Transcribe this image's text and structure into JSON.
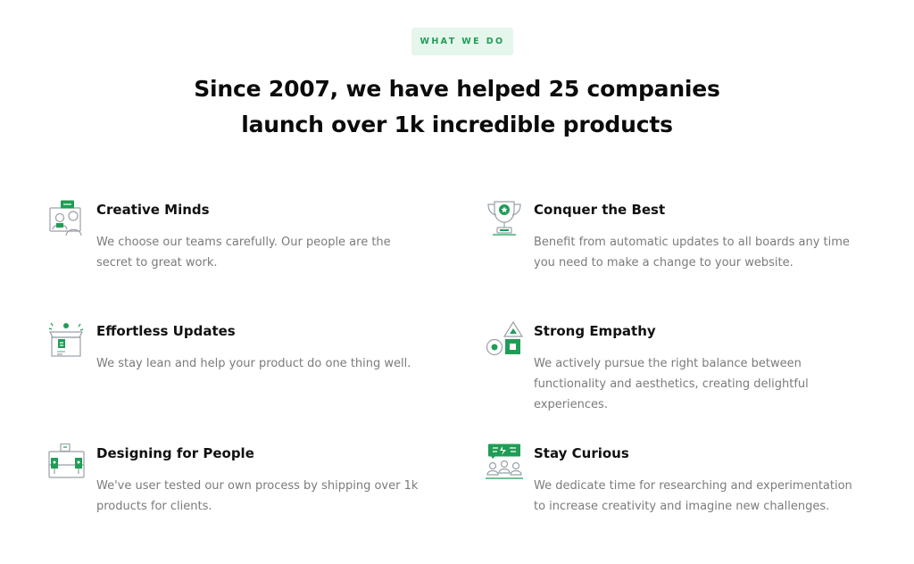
{
  "badge": "WHAT WE DO",
  "headline": {
    "line1": "Since 2007, we have helped 25 companies",
    "line2": "launch over 1k incredible products"
  },
  "colors": {
    "accent": "#1f9d55",
    "badge_bg": "#e5f6ec",
    "body_text": "#7b7b7b"
  },
  "features": [
    {
      "icon": "creative-minds-icon",
      "title": "Creative Minds",
      "description": "We choose our teams carefully. Our people are the secret to great work."
    },
    {
      "icon": "trophy-icon",
      "title": "Conquer the Best",
      "description": "Benefit from automatic updates to all boards any time you need to make a change to your website."
    },
    {
      "icon": "package-updates-icon",
      "title": "Effortless Updates",
      "description": "We stay lean and help your product do one thing well."
    },
    {
      "icon": "shapes-icon",
      "title": "Strong Empathy",
      "description": "We actively pursue the right balance between functionality and aesthetics, creating delightful experiences."
    },
    {
      "icon": "toolbox-icon",
      "title": "Designing for People",
      "description": "We've user tested our own process by shipping over 1k products for clients."
    },
    {
      "icon": "team-ideas-icon",
      "title": "Stay Curious",
      "description": "We dedicate time for researching and experimentation to increase creativity and imagine new challenges."
    }
  ]
}
